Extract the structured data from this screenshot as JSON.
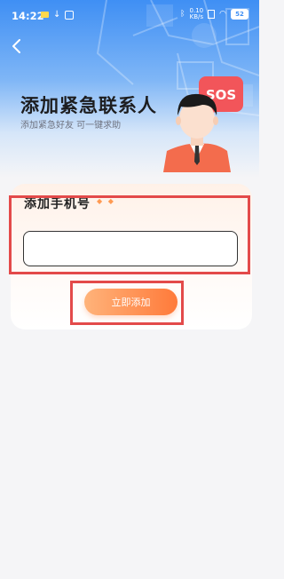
{
  "status_bar": {
    "time": "14:22",
    "net_speed_value": "0.10",
    "net_speed_unit": "KB/s",
    "battery": "52"
  },
  "header": {
    "back_icon": "chevron-left-icon",
    "title": "添加紧急联系人",
    "subtitle": "添加紧急好友 可一键求助",
    "sos_text": "SOS"
  },
  "card": {
    "title": "添加手机号",
    "phone_input": {
      "value": "",
      "placeholder": ""
    },
    "submit_label": "立即添加"
  },
  "colors": {
    "hero_blue": "#3f8ff4",
    "accent_orange": "#ff7a3a",
    "highlight_red": "#e34a4a",
    "sos_red": "#f2555a"
  }
}
